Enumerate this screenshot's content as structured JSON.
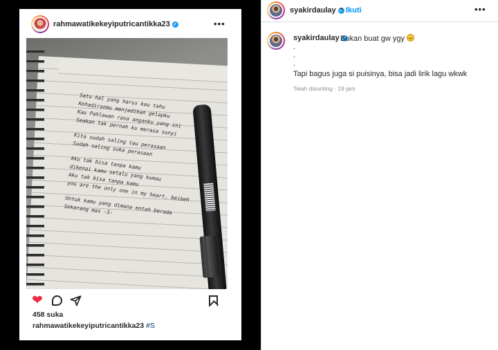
{
  "post": {
    "author": "rahmawatikekeyiputricantikka23",
    "verified_badge": "✓",
    "more": "•••",
    "likes": "458 suka",
    "caption_user": "rahmawatikekeyiputricantikka23",
    "caption_tag": "#S",
    "like_color": "#ed2d47",
    "image": {
      "handwriting_lines": [
        "Satu hal yang harus kau tahu",
        "Kehadiranmu menjadikan gelapku",
        "Kau Pahlawan rasa anganku yang ini",
        "Seakan tak pernah ku merasa sunyi",
        "",
        "Kita sudah saling tau perasaan",
        "Sudah saling suka perasaan",
        "",
        "Aku tak bisa tanpa kamu",
        "dikenai kamu selalu yang kumau",
        "Aku tak bisa tanpa kamu",
        "you are the only one in my heart, beibeh",
        "",
        "Untuk kamu yang dimana entah berada",
        "Sekarang mas -S-"
      ]
    }
  },
  "comment_panel": {
    "header": {
      "username": "syakirdaulay",
      "verified_badge": "✓",
      "separator": "•",
      "follow": "Ikuti",
      "more": "•••",
      "follow_color": "#0095f6"
    },
    "comment": {
      "username": "syakirdaulay",
      "verified_badge": "✓",
      "text_first": "Bukan buat gw ygy",
      "dot1": ".",
      "dot2": ".",
      "dot3": ".",
      "text_last": "Tapi bagus juga si puisinya, bisa jadi lirik lagu wkwk",
      "meta": "Telah disunting · 19 jam"
    }
  }
}
